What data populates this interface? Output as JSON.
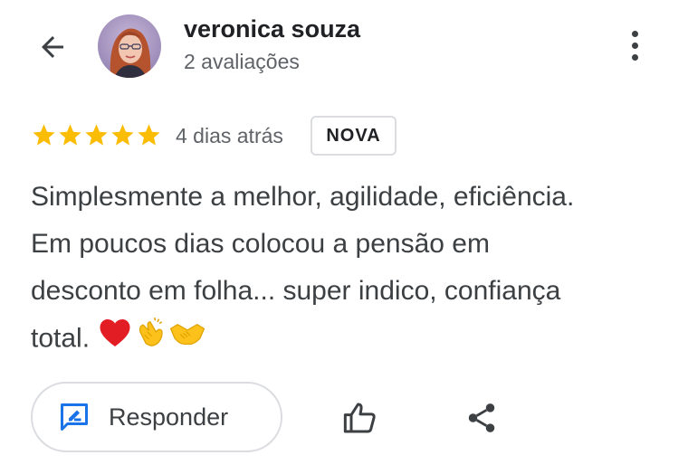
{
  "reviewer": {
    "name": "veronica souza",
    "review_count": "2 avaliações"
  },
  "rating": {
    "stars": 5,
    "max": 5,
    "star_color": "#fbbc04"
  },
  "review": {
    "time_ago": "4 dias atrás",
    "badge": "NOVA",
    "lines": [
      "Simplesmente a melhor, agilidade, eficiência.",
      "Em poucos dias colocou a pensão em",
      "desconto em folha... super indico, confiança",
      "total."
    ],
    "emojis": [
      "red-heart",
      "clapping-hands",
      "handshake"
    ]
  },
  "actions": {
    "reply_label": "Responder",
    "accent_color": "#1a73e8"
  },
  "icons": [
    "back-arrow-icon",
    "more-vert-icon",
    "reply-icon",
    "thumb-up-icon",
    "share-icon"
  ]
}
